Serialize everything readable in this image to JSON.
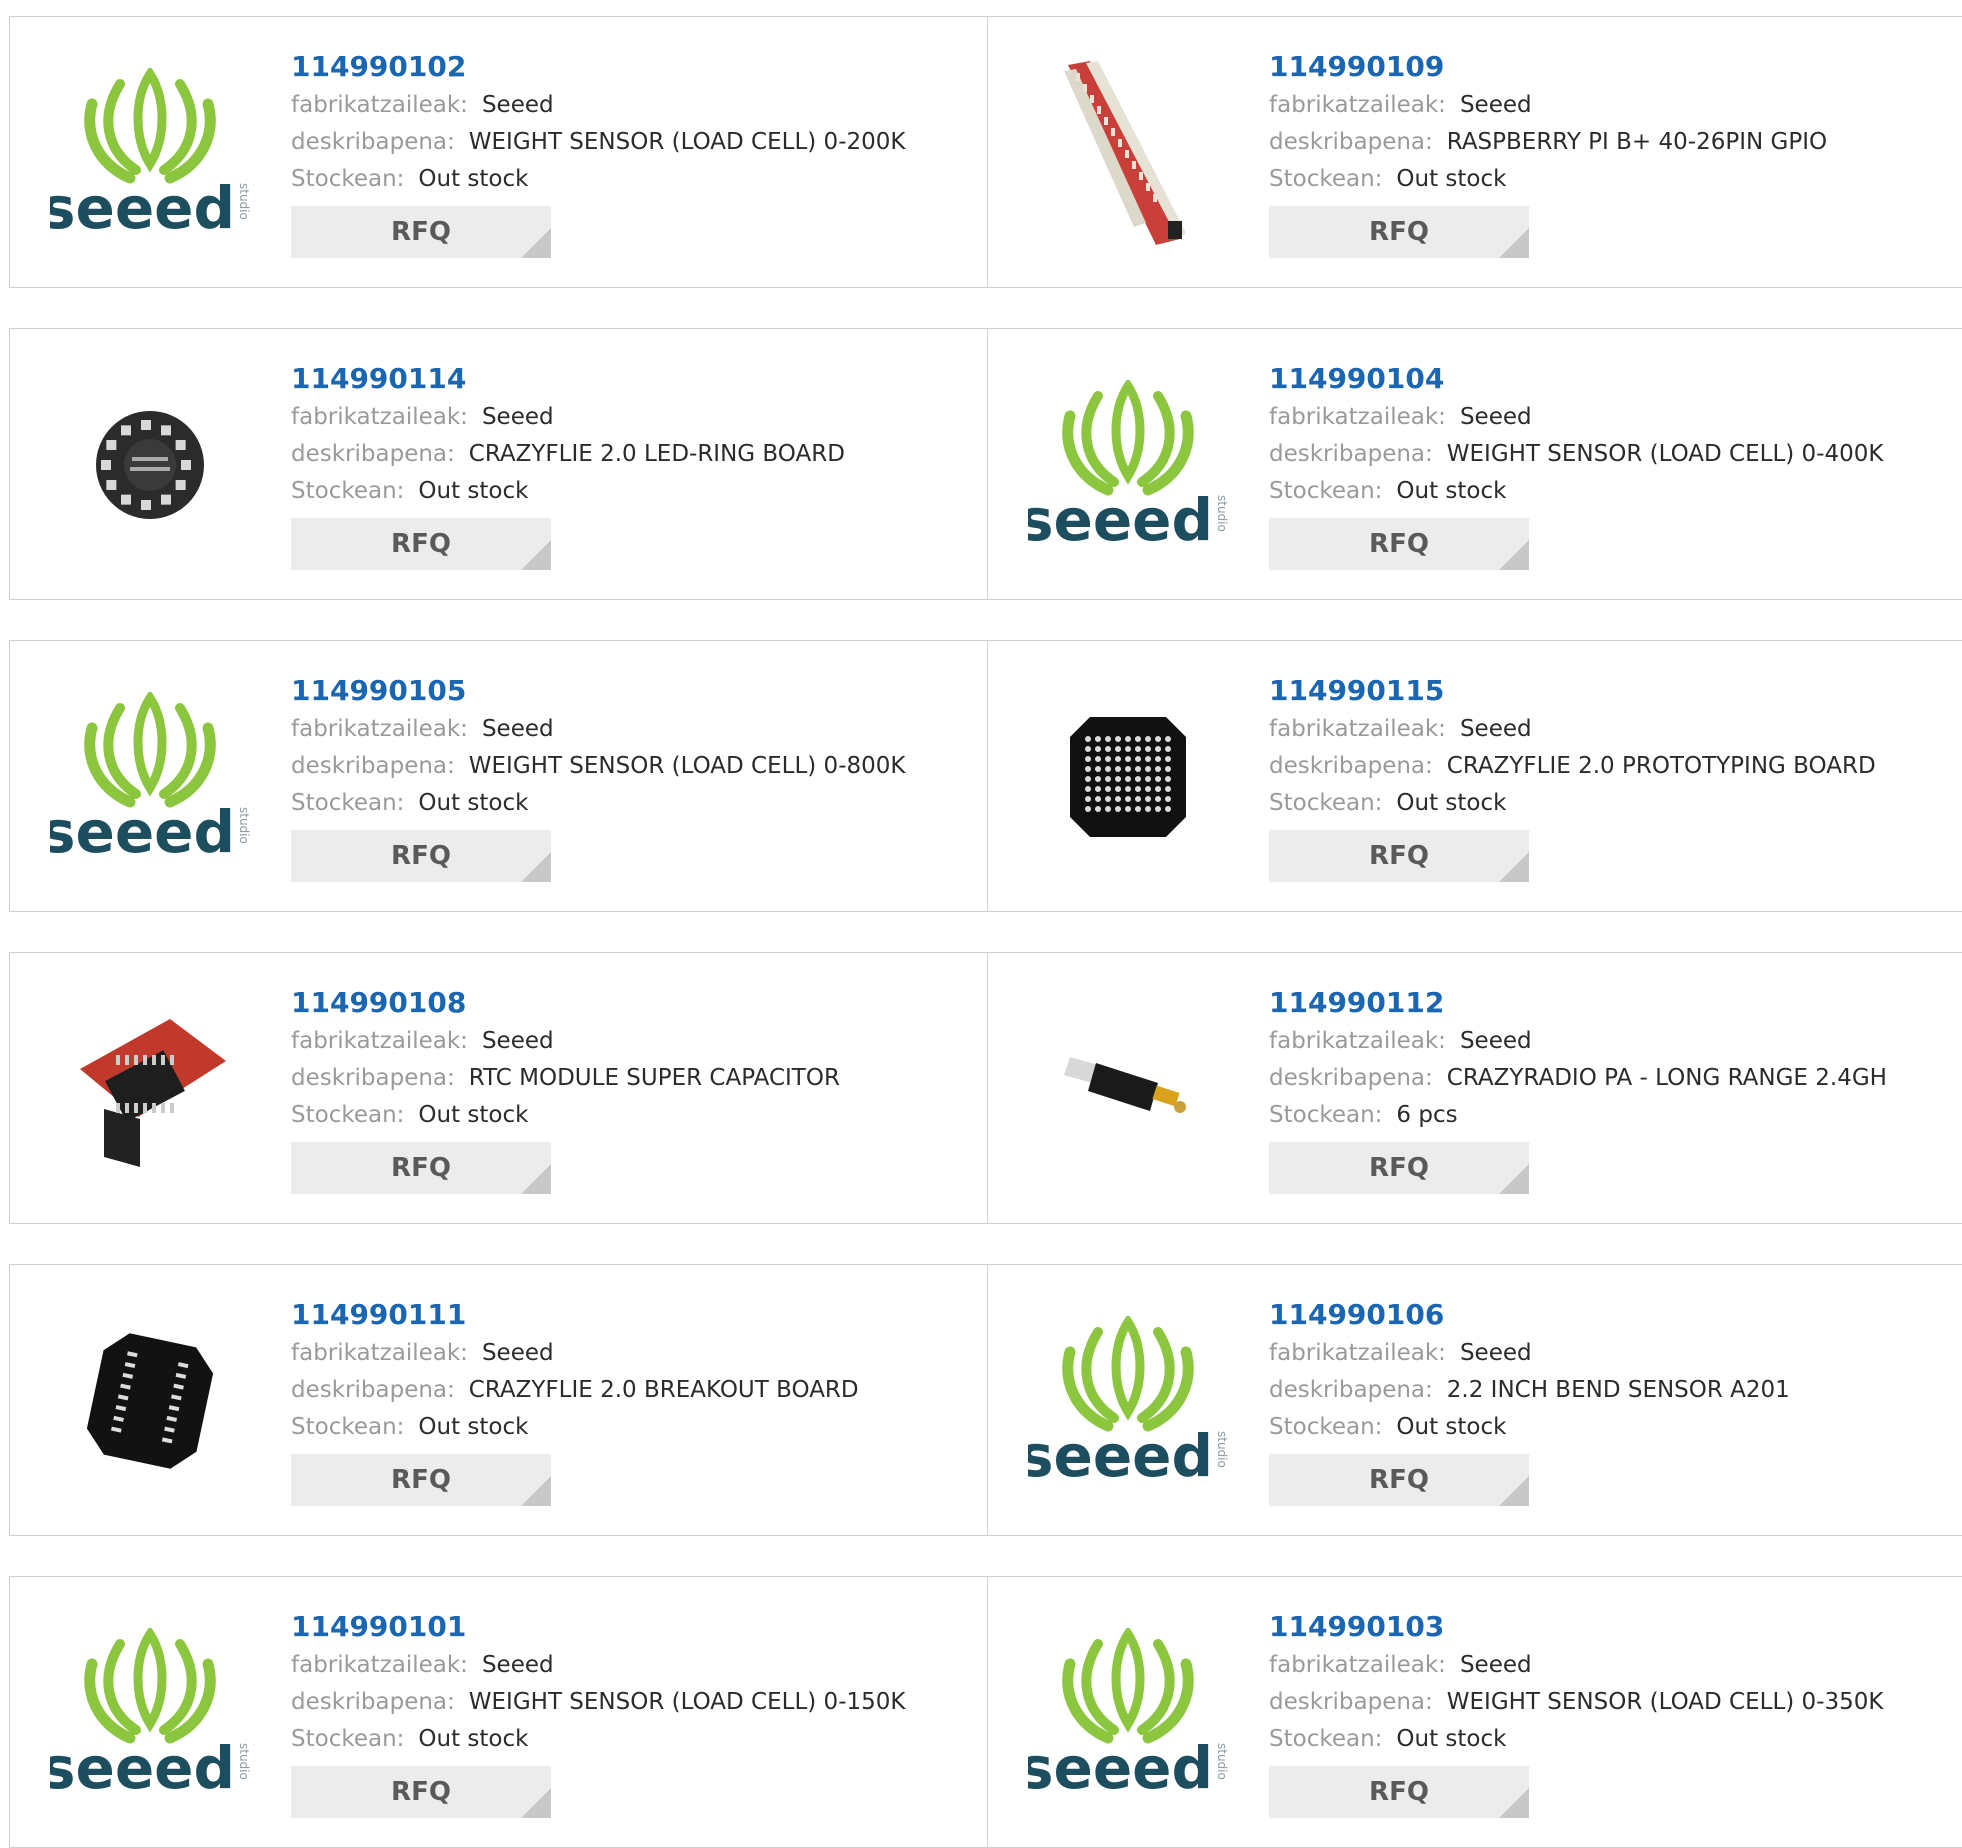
{
  "labels": {
    "manufacturer": "fabrikatzaileak:",
    "description": "deskribapena:",
    "stock": "Stockean:",
    "rfq": "RFQ"
  },
  "products": [
    {
      "part": "114990102",
      "manufacturer": "Seeed",
      "description": "WEIGHT SENSOR (LOAD CELL) 0-200K",
      "stock": "Out stock",
      "image": "seeed-logo"
    },
    {
      "part": "114990109",
      "manufacturer": "Seeed",
      "description": "RASPBERRY PI B+ 40-26PIN GPIO",
      "stock": "Out stock",
      "image": "gpio-adapter-photo"
    },
    {
      "part": "114990114",
      "manufacturer": "Seeed",
      "description": "CRAZYFLIE 2.0 LED-RING BOARD",
      "stock": "Out stock",
      "image": "led-ring-photo"
    },
    {
      "part": "114990104",
      "manufacturer": "Seeed",
      "description": "WEIGHT SENSOR (LOAD CELL) 0-400K",
      "stock": "Out stock",
      "image": "seeed-logo"
    },
    {
      "part": "114990105",
      "manufacturer": "Seeed",
      "description": "WEIGHT SENSOR (LOAD CELL) 0-800K",
      "stock": "Out stock",
      "image": "seeed-logo"
    },
    {
      "part": "114990115",
      "manufacturer": "Seeed",
      "description": "CRAZYFLIE 2.0 PROTOTYPING BOARD",
      "stock": "Out stock",
      "image": "prototyping-board-photo"
    },
    {
      "part": "114990108",
      "manufacturer": "Seeed",
      "description": "RTC MODULE SUPER CAPACITOR",
      "stock": "Out stock",
      "image": "rtc-module-photo"
    },
    {
      "part": "114990112",
      "manufacturer": "Seeed",
      "description": "CRAZYRADIO PA - LONG RANGE 2.4GH",
      "stock": "6 pcs",
      "image": "usb-radio-photo"
    },
    {
      "part": "114990111",
      "manufacturer": "Seeed",
      "description": "CRAZYFLIE 2.0 BREAKOUT BOARD",
      "stock": "Out stock",
      "image": "breakout-board-photo"
    },
    {
      "part": "114990106",
      "manufacturer": "Seeed",
      "description": "2.2 INCH BEND SENSOR A201",
      "stock": "Out stock",
      "image": "seeed-logo"
    },
    {
      "part": "114990101",
      "manufacturer": "Seeed",
      "description": "WEIGHT SENSOR (LOAD CELL) 0-150K",
      "stock": "Out stock",
      "image": "seeed-logo"
    },
    {
      "part": "114990103",
      "manufacturer": "Seeed",
      "description": "WEIGHT SENSOR (LOAD CELL) 0-350K",
      "stock": "Out stock",
      "image": "seeed-logo"
    }
  ],
  "brand": {
    "logo_text": "seeed",
    "logo_subtext": "studio",
    "logo_green": "#8cc63e",
    "logo_dark": "#1d4e5f"
  }
}
